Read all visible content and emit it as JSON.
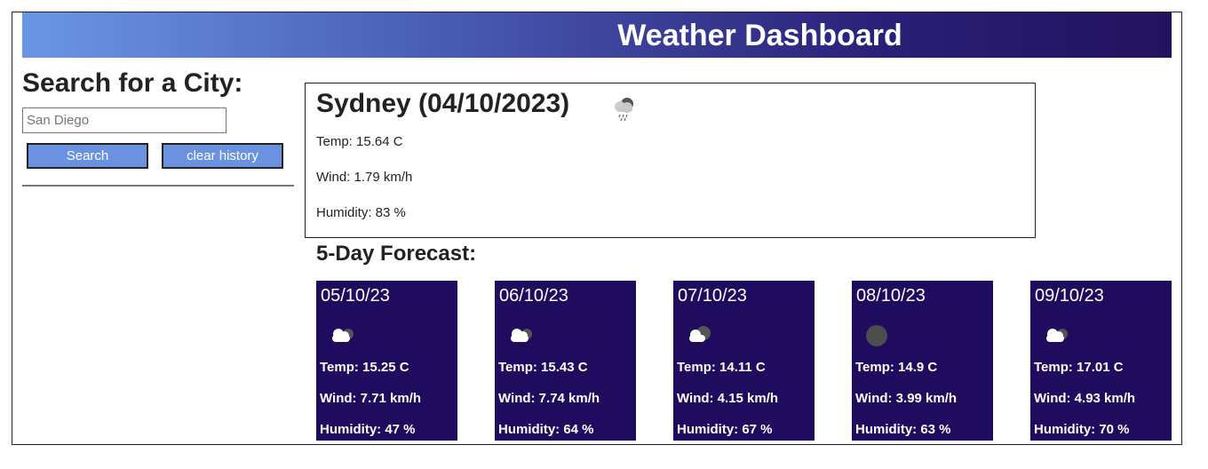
{
  "header": {
    "title": "Weather Dashboard"
  },
  "search": {
    "title": "Search for a City:",
    "placeholder": "San Diego",
    "search_label": "Search",
    "clear_label": "clear history"
  },
  "current": {
    "title": "Sydney (04/10/2023)",
    "icon": "rain-cloud-icon",
    "temp": "Temp: 15.64 C",
    "wind": "Wind: 1.79 km/h",
    "humidity": "Humidity: 83 %"
  },
  "forecast": {
    "title": "5-Day Forecast:",
    "days": [
      {
        "date": "05/10/23",
        "icon": "cloudy-icon",
        "temp": "Temp: 15.25 C",
        "wind": "Wind: 7.71 km/h",
        "humidity": "Humidity: 47 %"
      },
      {
        "date": "06/10/23",
        "icon": "cloudy-icon",
        "temp": "Temp: 15.43 C",
        "wind": "Wind: 7.74 km/h",
        "humidity": "Humidity: 64 %"
      },
      {
        "date": "07/10/23",
        "icon": "partly-cloudy-icon",
        "temp": "Temp: 14.11 C",
        "wind": "Wind: 4.15 km/h",
        "humidity": "Humidity: 67 %"
      },
      {
        "date": "08/10/23",
        "icon": "overcast-icon",
        "temp": "Temp: 14.9 C",
        "wind": "Wind: 3.99 km/h",
        "humidity": "Humidity: 63 %"
      },
      {
        "date": "09/10/23",
        "icon": "cloudy-icon",
        "temp": "Temp: 17.01 C",
        "wind": "Wind: 4.93 km/h",
        "humidity": "Humidity: 70 %"
      }
    ]
  }
}
